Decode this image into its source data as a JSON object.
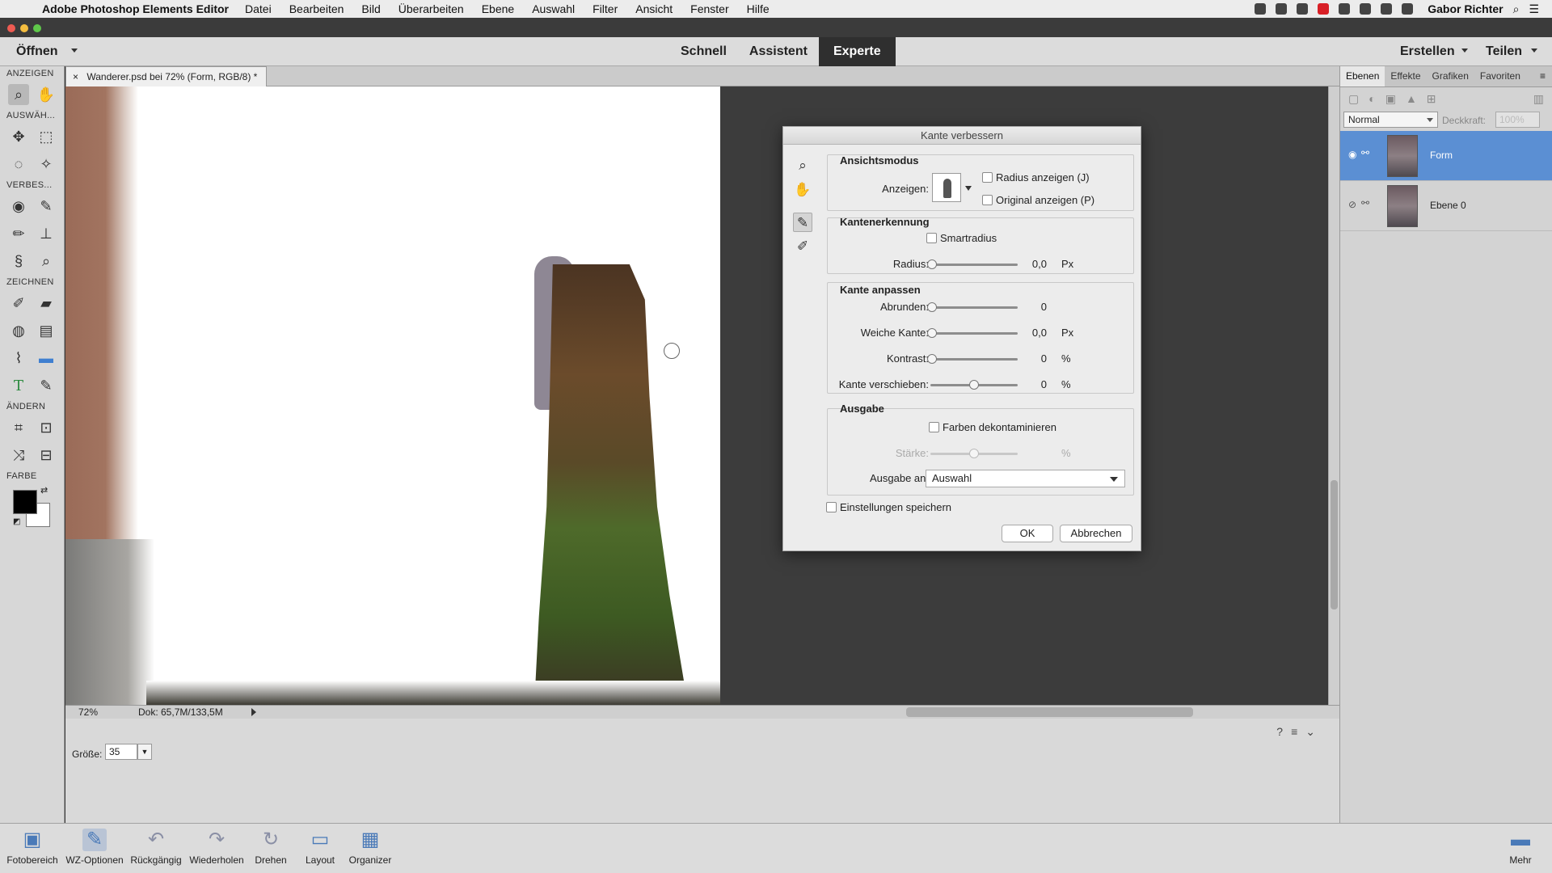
{
  "menubar": {
    "app_name": "Adobe Photoshop Elements Editor",
    "items": [
      "Datei",
      "Bearbeiten",
      "Bild",
      "Überarbeiten",
      "Ebene",
      "Auswahl",
      "Filter",
      "Ansicht",
      "Fenster",
      "Hilfe"
    ],
    "user": "Gabor Richter"
  },
  "header": {
    "open_label": "Öffnen",
    "modes": [
      "Schnell",
      "Assistent",
      "Experte"
    ],
    "active_mode": "Experte",
    "create_label": "Erstellen",
    "share_label": "Teilen"
  },
  "toolbox": {
    "sections": [
      "ANZEIGEN",
      "AUSWÄH...",
      "VERBES...",
      "ZEICHNEN",
      "ÄNDERN",
      "FARBE"
    ]
  },
  "document": {
    "tab_title": "Wanderer.psd bei 72% (Form, RGB/8) *",
    "close": "×",
    "zoom": "72%",
    "doc_info": "Dok: 65,7M/133,5M"
  },
  "tool_options": {
    "size_label": "Größe:",
    "size_value": "35"
  },
  "taskbar": {
    "items": [
      "Fotobereich",
      "WZ-Optionen",
      "Rückgängig",
      "Wiederholen",
      "Drehen",
      "Layout",
      "Organizer"
    ],
    "more": "Mehr"
  },
  "layers_panel": {
    "tabs": [
      "Ebenen",
      "Effekte",
      "Grafiken",
      "Favoriten"
    ],
    "active_tab": "Ebenen",
    "blend_mode": "Normal",
    "opacity_label": "Deckkraft:",
    "opacity_value": "100%",
    "layers": [
      {
        "name": "Form",
        "selected": true,
        "visible": true
      },
      {
        "name": "Ebene 0",
        "selected": false,
        "visible": false
      }
    ]
  },
  "dialog": {
    "title": "Kante verbessern",
    "view_mode": {
      "title": "Ansichtsmodus",
      "show_label": "Anzeigen:",
      "show_radius": "Radius anzeigen (J)",
      "show_original": "Original anzeigen (P)"
    },
    "edge_detection": {
      "title": "Kantenerkennung",
      "smart_radius": "Smartradius",
      "radius_label": "Radius:",
      "radius_value": "0,0",
      "radius_unit": "Px"
    },
    "adjust_edge": {
      "title": "Kante anpassen",
      "smooth_label": "Abrunden:",
      "smooth_value": "0",
      "feather_label": "Weiche Kante:",
      "feather_value": "0,0",
      "feather_unit": "Px",
      "contrast_label": "Kontrast:",
      "contrast_value": "0",
      "contrast_unit": "%",
      "shift_label": "Kante verschieben:",
      "shift_value": "0",
      "shift_unit": "%"
    },
    "output": {
      "title": "Ausgabe",
      "decontaminate": "Farben dekontaminieren",
      "amount_label": "Stärke:",
      "amount_unit": "%",
      "output_to_label": "Ausgabe an:",
      "output_to_value": "Auswahl"
    },
    "remember": "Einstellungen speichern",
    "ok": "OK",
    "cancel": "Abbrechen"
  }
}
